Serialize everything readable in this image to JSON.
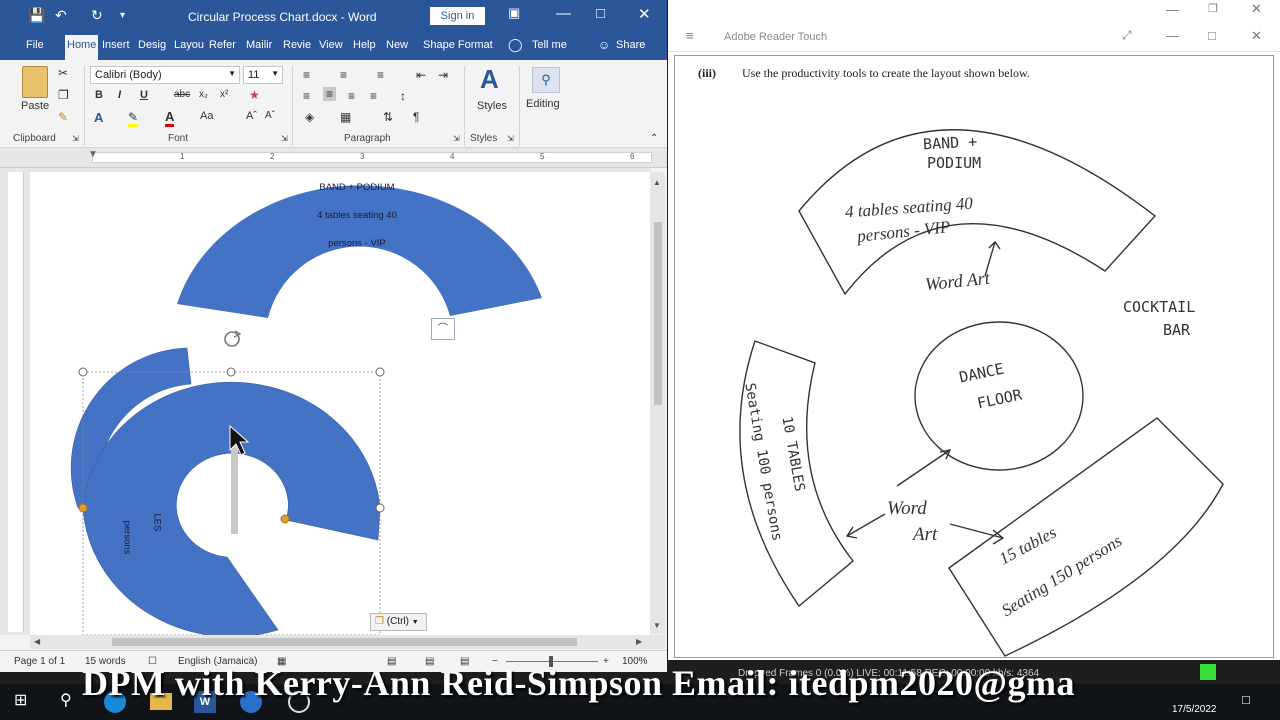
{
  "word": {
    "title_bar": {
      "document_title": "Circular Process Chart.docx - Word",
      "sign_in": "Sign in"
    },
    "tabs": [
      "File",
      "Home",
      "Insert",
      "Desig",
      "Layou",
      "Refer",
      "Mailir",
      "Revie",
      "View",
      "Help",
      "New",
      "Shape Format"
    ],
    "tell_me": "Tell me",
    "share": "Share",
    "ribbon": {
      "clipboard": {
        "paste": "Paste",
        "label": "Clipboard"
      },
      "font": {
        "name": "Calibri (Body)",
        "size": "11",
        "label": "Font"
      },
      "paragraph": {
        "label": "Paragraph"
      },
      "styles": {
        "button": "Styles",
        "label": "Styles"
      },
      "editing": {
        "button": "Editing"
      }
    },
    "ruler_numbers": [
      "1",
      "2",
      "3",
      "4",
      "5",
      "6"
    ],
    "document": {
      "shape_text_line1": "BAND + PODIUM",
      "shape_text_line2": "4 tables seating 40",
      "shape_text_line3": "persons - VIP",
      "rotated_text_a": "LES",
      "rotated_text_b": "persons",
      "paste_options": "(Ctrl)"
    },
    "status": {
      "page": "Page 1 of 1",
      "words": "15 words",
      "language": "English (Jamaica)",
      "zoom": "100%"
    },
    "colors": {
      "title": "#2b579a",
      "shape_fill": "#4472c4"
    }
  },
  "adobe": {
    "app_title": "Adobe Reader Touch",
    "instruction_num": "(iii)",
    "instruction": "Use the productivity tools to create the layout shown below.",
    "sketch": {
      "top_label_1": "BAND +",
      "top_label_2": "PODIUM",
      "top_text_1": "4 tables seating 40",
      "top_text_2": "persons - VIP",
      "wordart_top": "Word Art",
      "cocktail_1": "COCKTAIL",
      "cocktail_2": "BAR",
      "dance_1": "DANCE",
      "dance_2": "FLOOR",
      "left_text_1": "10 TABLES",
      "left_text_2": "Seating 100 persons",
      "wordart_mid_1": "Word",
      "wordart_mid_2": "Art",
      "right_text_1": "15 tables",
      "right_text_2": "Seating 150 persons"
    }
  },
  "overlay": {
    "banner": "DPM with Kerry-Ann Reid-Simpson  Email: itedpm2020@gma",
    "obs_stats": "Dropped Frames 0 (0.0%)   LIVE: 00:11:58   REC: 00:00:00   kb/s: 4364",
    "date": "17/5/2022"
  }
}
